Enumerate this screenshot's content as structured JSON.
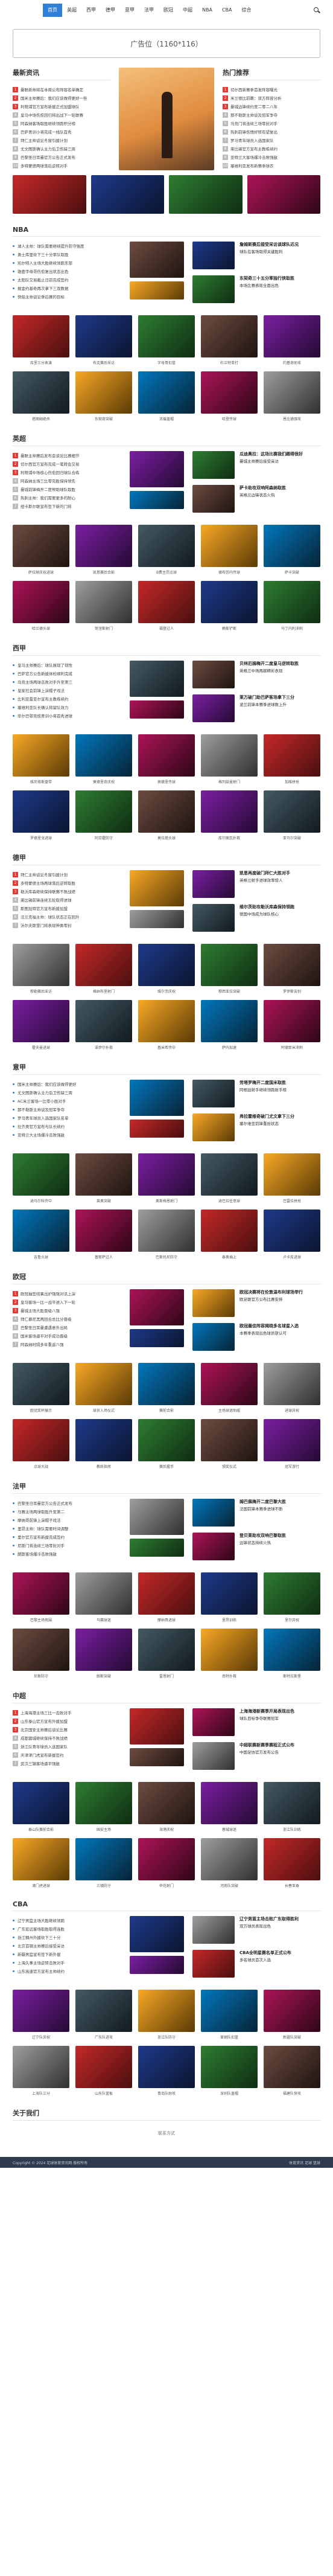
{
  "nav": {
    "items": [
      "首页",
      "英超",
      "西甲",
      "德甲",
      "意甲",
      "法甲",
      "欧冠",
      "中超",
      "NBA",
      "CBA",
      "综合"
    ],
    "active_index": 0
  },
  "ad": {
    "label": "广告位（1160*116）"
  },
  "hot": {
    "left_title": "最新资讯",
    "left_items": [
      "曼联新帅将在本周公布阵容名单确定",
      "国米主帅赛后：我们应该做得更好一些",
      "利物浦官方宣布新援正式加盟球队",
      "皇马中场伤愈回归将出战下一轮联赛",
      "阿森纳客场取胜继续领跑积分榜",
      "巴萨青训小将完成一线队首秀",
      "拜仁主帅谈论冬窗引援计划",
      "尤文图斯确认主力后卫伤缺三周",
      "巴黎圣日耳曼官方公告正式发布",
      "多特蒙德两球落后逆转对手"
    ],
    "right_title": "热门推荐",
    "right_items": [
      "切尔西新赛季首发阵容曝光",
      "米兰德比前瞻：双方阵容分析",
      "曼城边锋续约至二零二八年",
      "那不勒斯主帅谈及冠军争夺",
      "马竞门将连续三场零封对手",
      "热刺前锋伤情好转有望复出",
      "罗马青年球员入选国家队",
      "莱比锡官方宣布主教练续约",
      "亚特兰大客场爆冷击败强敌",
      "塞维利亚发布新赛季球衣"
    ]
  },
  "sections": [
    {
      "title": "NBA",
      "list": [
        "湖人主帅：球队需要继续提升防守强度",
        "勇士库里砍下三十分率队取胜",
        "凯尔特人主场大胜继续领跑东部",
        "雄鹿字母哥伤愈复出状态出色",
        "太阳队交易截止日前完成签约",
        "掘金约基奇再次拿下三双数据",
        "快船主帅谈论季后赛的目标"
      ],
      "news": [
        {
          "title": "詹姆斯赛后接受采访谈球队近况",
          "desc": "球队在客场取得关键胜利"
        },
        {
          "title": "东契奇三十五分率独行侠取胜",
          "desc": "本场比赛表现全面出色"
        }
      ],
      "thumbs": [
        "库里三分表演",
        "布克赛后采访",
        "字母哥扣篮",
        "杜兰特单打",
        "约基奇助攻",
        "塔图姆绝杀",
        "东契奇突破",
        "浓眉盖帽",
        "哈登传球",
        "恩比德强攻"
      ]
    },
    {
      "title": "英超",
      "list": [
        "曼联主帅赛后发布会谈论比赛细节",
        "切尔西官方宣布完成一笔转会交易",
        "利物浦中场核心伤愈回归球队合练",
        "阿森纳主场三比零完胜保持领先",
        "曼城前锋梅开二度帮助球队取胜",
        "热刺主帅：我们需要更多的耐心",
        "纽卡斯尔联宣布签下新的门将"
      ],
      "news": [
        {
          "title": "瓜迪奥拉：这场比赛我们踢得很好",
          "desc": "曼城主帅赛后接受采访"
        },
        {
          "title": "萨卡助攻双响阿森纳取胜",
          "desc": "英格兰边锋状态火热"
        }
      ],
      "thumbs": [
        "萨拉赫庆祝进球",
        "凯恩赛后合影",
        "B费主罚点球",
        "德布劳内传球",
        "萨卡突破",
        "哈兰德头球",
        "努涅斯射门",
        "福登过人",
        "赖斯铲断",
        "马丁内利冲刺"
      ]
    },
    {
      "title": "西甲",
      "list": [
        "皇马主帅赛后：球队展现了韧性",
        "巴萨官方公告新援体检顺利完成",
        "马竞主场两球击败对手升至第三",
        "皇家社会前锋上演帽子戏法",
        "比利亚雷亚尔宣布主教练续约",
        "塞维利亚队长确认将留队效力",
        "毕尔巴鄂竞技青训小将首秀进球"
      ],
      "news": [
        {
          "title": "贝林厄姆梅开二度皇马逆转取胜",
          "desc": "英格兰中场再献精彩表现"
        },
        {
          "title": "莱万破门助巴萨客场拿下三分",
          "desc": "波兰前锋本赛季进球数上升"
        }
      ],
      "thumbs": [
        "维尼修斯盘带",
        "莫德里奇庆祝",
        "佩德里传球",
        "格列兹曼射门",
        "加维拼抢",
        "罗德里戈进球",
        "阿劳霍防守",
        "莫拉塔头球",
        "库尔图瓦扑救",
        "亚马尔突破"
      ]
    },
    {
      "title": "德甲",
      "list": [
        "拜仁主帅谈论冬窗引援计划",
        "多特蒙德主场两球落后逆转取胜",
        "勒沃库森继续保持联赛不败战绩",
        "莱比锡前锋连续五轮取得进球",
        "斯图加特官方宣布新援加盟",
        "法兰克福主帅：球队状态正在回升",
        "沃尔夫斯堡门将表现神勇零封"
      ],
      "news": [
        {
          "title": "凯恩再度破门拜仁大胜对手",
          "desc": "英格兰射手进球效率惊人"
        },
        {
          "title": "维尔茨助攻勒沃库森保持领跑",
          "desc": "德国中场成为球队核心"
        }
      ],
      "thumbs": [
        "穆勒赛后采访",
        "格纳布里射门",
        "维尔茨庆祝",
        "穆西亚拉突破",
        "罗伊斯告别",
        "霍夫曼进球",
        "诺伊尔扑救",
        "基米希传中",
        "萨内加速",
        "阿德耶米冲刺"
      ]
    },
    {
      "title": "意甲",
      "list": [
        "国米主帅赛后：我们应该做得更好",
        "尤文图斯确认主力后卫伤缺三周",
        "AC米兰客场一比零小胜对手",
        "那不勒斯主帅谈及冠军争夺",
        "罗马青年球员入选国家队名单",
        "拉齐奥官方宣布与队长续约",
        "亚特兰大主场爆冷击败强敌"
      ],
      "news": [
        {
          "title": "劳塔罗梅开二度国米取胜",
          "desc": "阿根廷射手继续领跑射手榜"
        },
        {
          "title": "弗拉霍维奇破门尤文拿下三分",
          "desc": "塞尔维亚前锋重拾状态"
        }
      ],
      "thumbs": [
        "迪马尔科传中",
        "莱奥突破",
        "奥斯梅恩射门",
        "迪巴拉任意球",
        "巴雷拉拼抢",
        "吉鲁头球",
        "基耶萨过人",
        "巴斯托尼防守",
        "泰奥插上",
        "卢卡库进球"
      ]
    },
    {
      "title": "欧冠",
      "list": [
        "欧冠抽签结果出炉强强对话上演",
        "皇马客场一比一战平进入下一轮",
        "曼城主场大胜晋级八强",
        "拜仁慕尼黑两回合总比分晋级",
        "巴黎圣日耳曼遭遇意外出局",
        "国米客场逼平对手成功晋级",
        "阿森纳时隔多年重返八强"
      ],
      "news": [
        {
          "title": "欧冠决赛将在伦敦温布利球场举行",
          "desc": "欧足联官方公布比赛安排"
        },
        {
          "title": "欧冠最佳阵容揭晓多名球星入选",
          "desc": "本赛季表现出色球员获认可"
        }
      ],
      "thumbs": [
        "欧冠奖杯展示",
        "球员入场仪式",
        "赛前合影",
        "主场球迷助威",
        "进球庆祝",
        "点球大战",
        "教练指挥",
        "赛后握手",
        "颁奖仪式",
        "冠军游行"
      ]
    },
    {
      "title": "法甲",
      "list": [
        "巴黎圣日耳曼官方公告正式发布",
        "马赛主场两球取胜升至第二",
        "摩纳哥前锋上演帽子戏法",
        "里昂主帅：球队需要时间调整",
        "里尔官方宣布新援完成签约",
        "尼斯门将连续三场零封对手",
        "朗斯客场爆冷击败强敌"
      ],
      "news": [
        {
          "title": "姆巴佩梅开二度巴黎大胜",
          "desc": "法国前锋本赛季进球不断"
        },
        {
          "title": "登贝莱助攻双响巴黎取胜",
          "desc": "边锋状态持续火热"
        }
      ],
      "thumbs": [
        "巴黎主场氛围",
        "马赛球迷",
        "摩纳哥进球",
        "里昂训练",
        "里尔庆祝",
        "尼斯防守",
        "朗斯突破",
        "雷恩射门",
        "南特扑救",
        "斯特拉斯堡"
      ]
    },
    {
      "title": "中超",
      "list": [
        "上海海港主场三比一击败对手",
        "山东泰山官方宣布外援加盟",
        "北京国安主帅赛后谈论比赛",
        "成都蓉城继续保持不败战绩",
        "浙江队青年球员入选国家队",
        "天津津门虎宣布新援签约",
        "武汉三镇客场逼平强敌"
      ],
      "news": [
        {
          "title": "上海海港新赛季开局表现出色",
          "desc": "球队目标争夺联赛冠军"
        },
        {
          "title": "中超联赛新赛季赛程正式公布",
          "desc": "中国足协官方发布公告"
        }
      ],
      "thumbs": [
        "泰山队赛前合影",
        "国安主场",
        "海港庆祝",
        "蓉城球迷",
        "浙江队训练",
        "津门虎进球",
        "三镇防守",
        "申花射门",
        "河南队突破",
        "长春亚泰"
      ]
    },
    {
      "title": "CBA",
      "list": [
        "辽宁男篮主场大胜继续领跑",
        "广东宏远客场取胜取得连胜",
        "浙江稠州外援砍下三十分",
        "北京首钢主帅赛后接受采访",
        "新疆男篮宣布签下新外援",
        "上海久事主场逆转击败对手",
        "山东高速官方宣布主帅续约"
      ],
      "news": [
        {
          "title": "辽宁男篮主场击败广东取得胜利",
          "desc": "双方球员表现出色"
        },
        {
          "title": "CBA全明星赛名单正式公布",
          "desc": "多名球员首次入选"
        }
      ],
      "thumbs": [
        "辽宁队庆祝",
        "广东队进攻",
        "浙江队防守",
        "首钢队扣篮",
        "新疆队突破",
        "上海队三分",
        "山东队篮板",
        "青岛队助攻",
        "深圳队盖帽",
        "福建队快攻"
      ]
    }
  ],
  "about": {
    "title": "关于我们",
    "text": "联系方式"
  },
  "footer": {
    "left": "Copyright © 2024 足球体育资讯网 版权所有",
    "right": "体育资讯 足球 篮球"
  }
}
